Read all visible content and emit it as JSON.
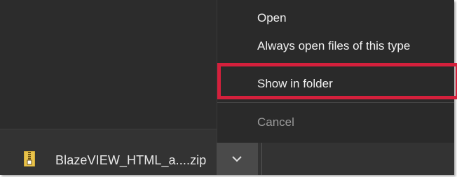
{
  "context_menu": {
    "items": [
      {
        "label": "Open",
        "enabled": true
      },
      {
        "label": "Always open files of this type",
        "enabled": true
      },
      {
        "label": "Show in folder",
        "enabled": true,
        "highlighted": true
      },
      {
        "label": "Cancel",
        "enabled": false
      }
    ]
  },
  "download_shelf": {
    "file_name": "BlazeVIEW_HTML_a....zip",
    "file_icon": "zip-archive-icon",
    "menu_button_icon": "chevron-down-icon"
  },
  "colors": {
    "background": "#2b2b2b",
    "menu_background": "#2a2a2a",
    "highlight_border": "#d4203c",
    "text": "#f0f0f0",
    "disabled_text": "#9a9a9a"
  }
}
